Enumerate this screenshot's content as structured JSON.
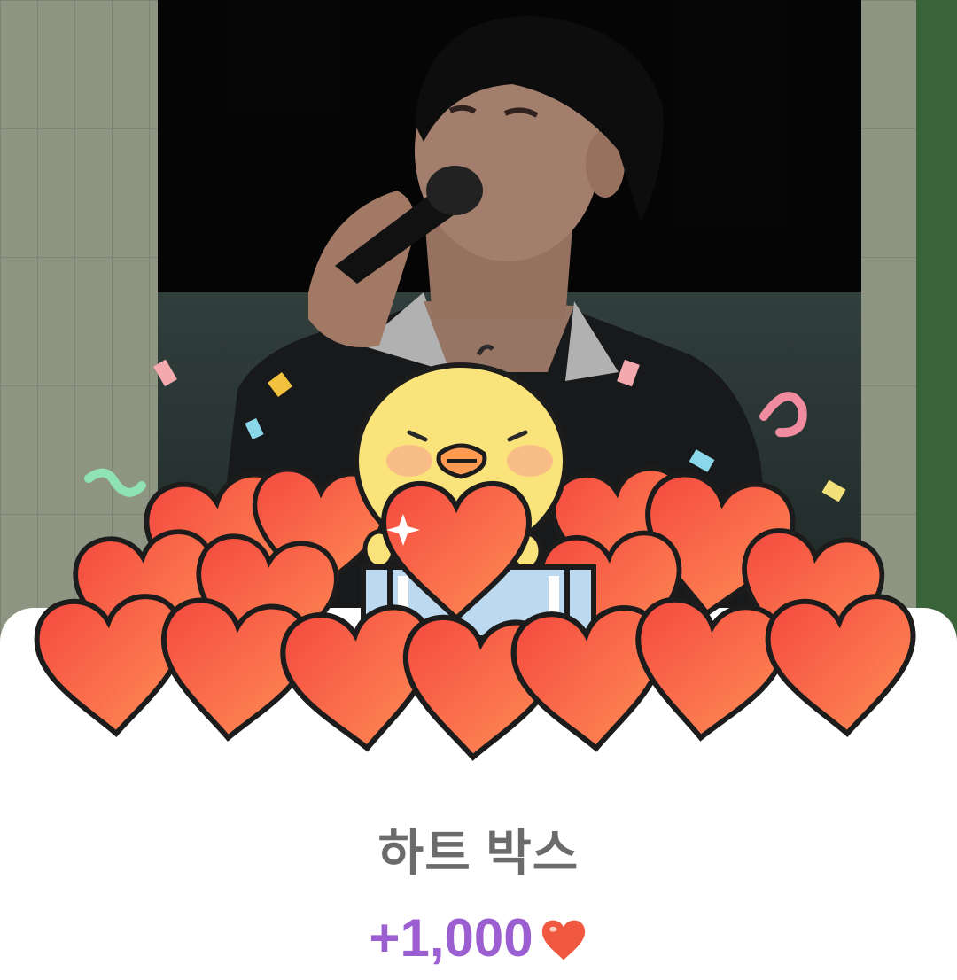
{
  "dialog": {
    "title": "하트 박스",
    "reward_amount": "+1,000"
  },
  "icons": {
    "reward_icon": "heart-icon",
    "mascot": "yellow-chick-holding-heart"
  },
  "colors": {
    "title_text": "#6b6b6b",
    "reward_text": "#9b5fd2",
    "heart_fill": "#f0593f",
    "sheet_background": "#ffffff"
  }
}
